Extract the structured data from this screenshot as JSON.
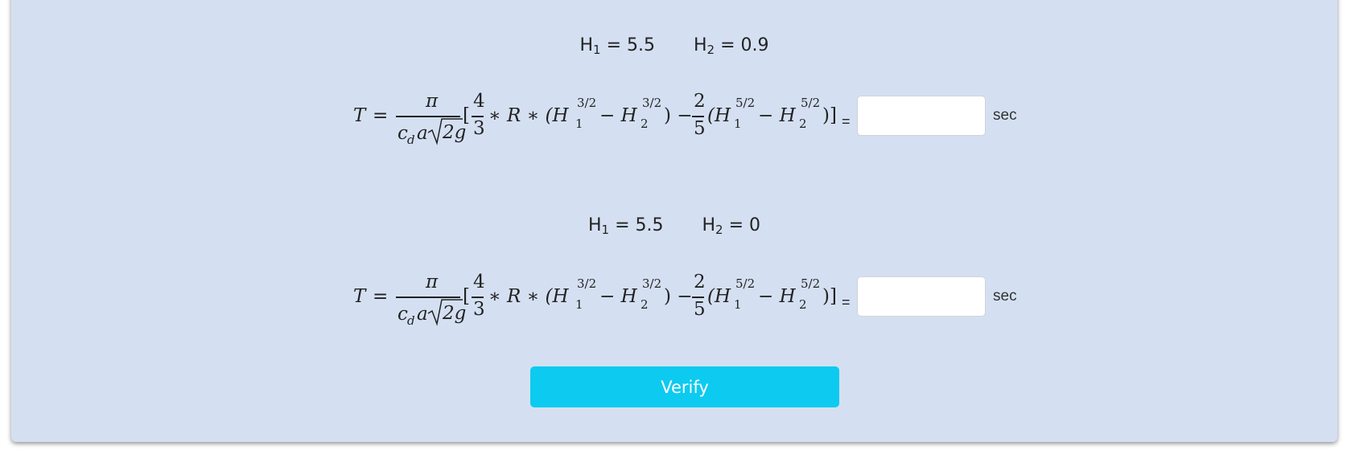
{
  "problems": [
    {
      "h1_label": "H",
      "h1_sub": "1",
      "h1_value": "= 5.5",
      "h2_label": "H",
      "h2_sub": "2",
      "h2_value": "= 0.9",
      "equals": "=",
      "answer_value": "",
      "unit": "sec"
    },
    {
      "h1_label": "H",
      "h1_sub": "1",
      "h1_value": "= 5.5",
      "h2_label": "H",
      "h2_sub": "2",
      "h2_value": "= 0",
      "equals": "=",
      "answer_value": "",
      "unit": "sec"
    }
  ],
  "formula": {
    "lhs": "T",
    "eq": "=",
    "pi": "π",
    "cd": "c",
    "cd_sub": "d",
    "a": "a",
    "sqrt2g": "2g",
    "open_bracket": "[",
    "four": "4",
    "three": "3",
    "times_R": "∗ R ∗ (H",
    "sub1": "1",
    "exp32": "3/2",
    "minus_H": "− H",
    "sub2": "2",
    "close_minus": ") −",
    "two": "2",
    "five": "5",
    "open_H": "(H",
    "exp52": "5/2",
    "close": ")]"
  },
  "verify_label": "Verify"
}
